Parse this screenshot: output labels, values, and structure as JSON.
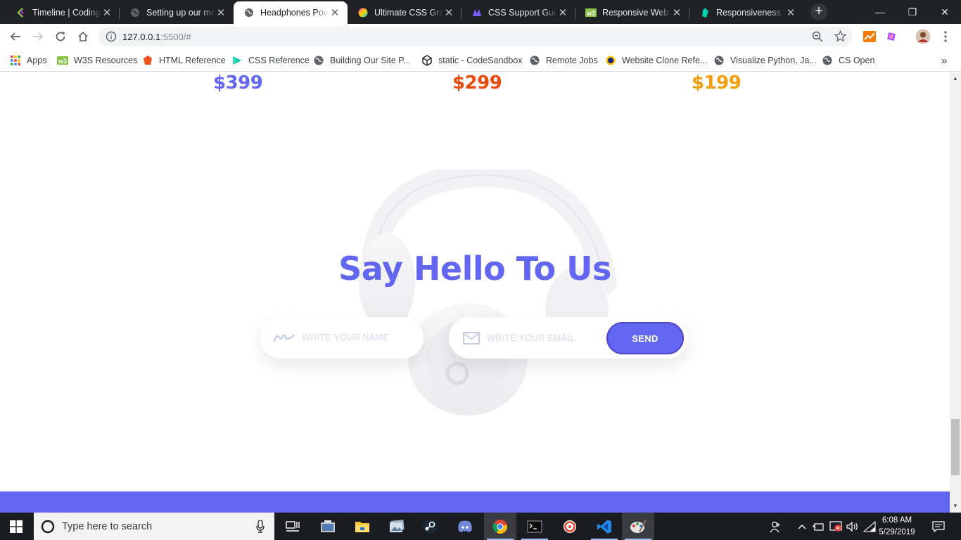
{
  "browser": {
    "tabs": [
      {
        "title": "Timeline | CodingPh",
        "icon": "codingphase-icon"
      },
      {
        "title": "Setting up our menu",
        "icon": "globe-icon"
      },
      {
        "title": "Headphones Power",
        "icon": "globe-icon",
        "active": true
      },
      {
        "title": "Ultimate CSS Gradient",
        "icon": "gradient-icon"
      },
      {
        "title": "CSS Support Guide",
        "icon": "css-guide-icon"
      },
      {
        "title": "Responsive Web De",
        "icon": "w3-icon"
      },
      {
        "title": "Responsiveness | Be",
        "icon": "bulma-icon"
      }
    ],
    "new_tab": "+",
    "address": {
      "host": "127.0.0.1",
      "path": ":5500/#"
    },
    "bookmarks": [
      {
        "label": "Apps",
        "icon": "apps-grid-icon"
      },
      {
        "label": "W3S Resources",
        "icon": "w3-icon"
      },
      {
        "label": "HTML Reference",
        "icon": "html-icon"
      },
      {
        "label": "CSS Reference",
        "icon": "css-icon"
      },
      {
        "label": "Building Our Site P...",
        "icon": "globe-icon"
      },
      {
        "label": "static - CodeSandbox",
        "icon": "codesandbox-icon"
      },
      {
        "label": "Remote Jobs",
        "icon": "globe-icon"
      },
      {
        "label": "Website Clone Refe...",
        "icon": "dot-icon"
      },
      {
        "label": "Visualize Python, Ja...",
        "icon": "globe-icon"
      },
      {
        "label": "CS Open",
        "icon": "globe-icon"
      }
    ],
    "more_bookmarks": "»"
  },
  "page": {
    "prices": [
      {
        "value": "$399",
        "color": "#6366f1"
      },
      {
        "value": "$299",
        "color": "#ea4a0c"
      },
      {
        "value": "$199",
        "color": "#f59e0b"
      }
    ],
    "heading": "Say Hello To Us",
    "form": {
      "name_placeholder": "WRITE YOUR NAME",
      "email_placeholder": "WRITE YOUR EMAIL",
      "send_label": "SEND"
    },
    "accent": "#6366f1"
  },
  "taskbar": {
    "search_placeholder": "Type here to search",
    "time": "6:08 AM",
    "date": "5/29/2019"
  }
}
